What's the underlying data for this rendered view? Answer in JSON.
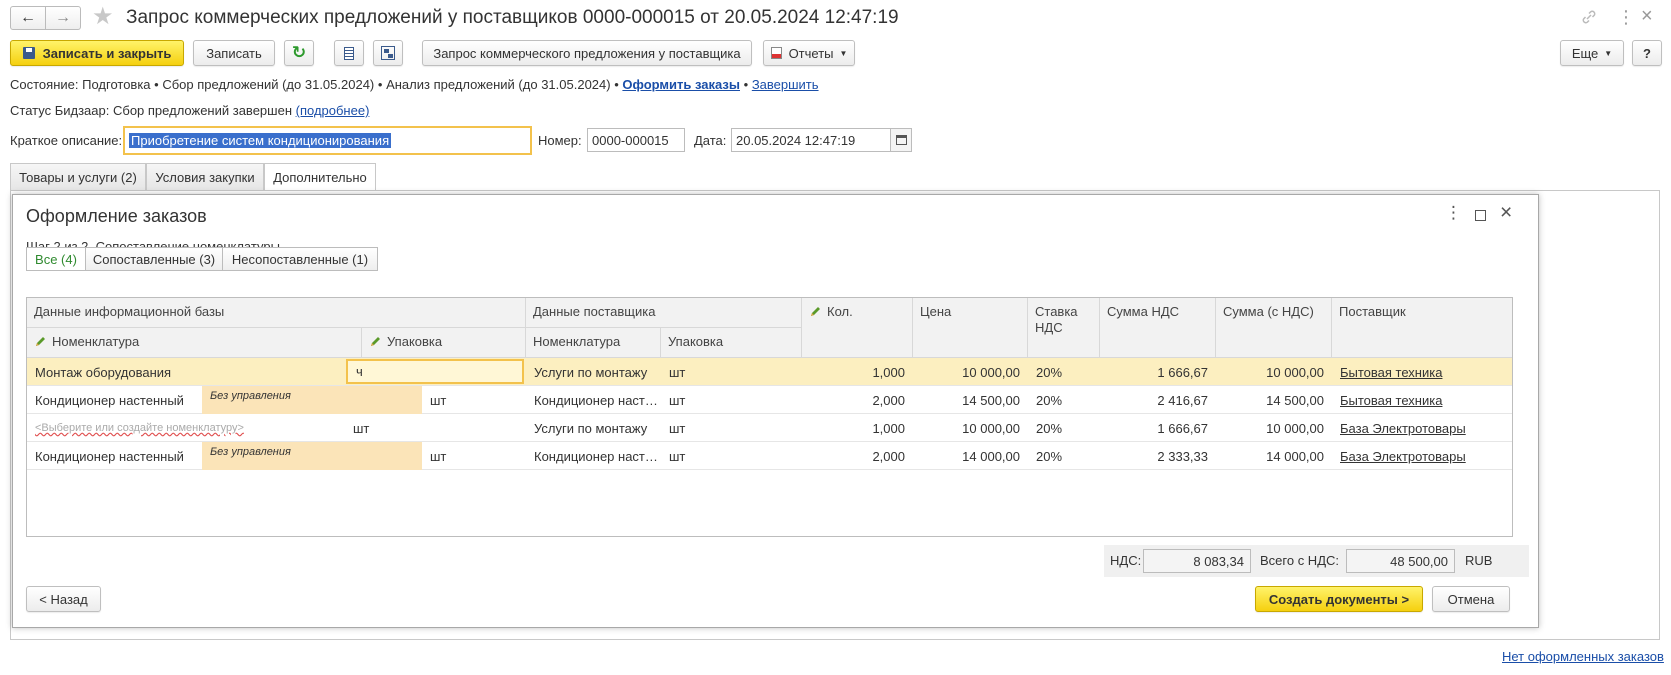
{
  "window": {
    "title": "Запрос коммерческих предложений у поставщиков 0000-000015 от 20.05.2024 12:47:19"
  },
  "toolbar": {
    "save_close": "Записать и закрыть",
    "save": "Записать",
    "request": "Запрос коммерческого предложения у поставщика",
    "reports": "Отчеты",
    "more": "Еще",
    "help": "?"
  },
  "status": {
    "label": "Состояние:",
    "steps": [
      "Подготовка",
      "Сбор предложений (до 31.05.2024)",
      "Анализ предложений (до 31.05.2024)"
    ],
    "make_orders": "Оформить заказы",
    "finish": "Завершить",
    "bidzaar_label": "Статус Бидзаар:",
    "bidzaar_value": "Сбор предложений завершен",
    "bidzaar_more": "(подробнее)"
  },
  "form": {
    "desc_label": "Краткое описание:",
    "desc_value": "Приобретение систем кондиционирования",
    "number_label": "Номер:",
    "number_value": "0000-000015",
    "date_label": "Дата:",
    "date_value": "20.05.2024 12:47:19"
  },
  "tabs": [
    "Товары и услуги (2)",
    "Условия закупки",
    "Дополнительно"
  ],
  "dialog": {
    "title": "Оформление заказов",
    "step": "Шаг 2 из 2. Сопоставление номенклатуры",
    "filters": [
      "Все (4)",
      "Сопоставленные (3)",
      "Несопоставленные (1)"
    ],
    "headers": {
      "ib_data": "Данные информационной базы",
      "supplier_data": "Данные поставщика",
      "nomenclature": "Номенклатура",
      "package": "Упаковка",
      "sup_nomenclature": "Номенклатура",
      "sup_package": "Упаковка",
      "qty": "Кол.",
      "price": "Цена",
      "vat_rate": "Ставка НДС",
      "vat_sum": "Сумма НДС",
      "sum_with_vat": "Сумма (с НДС)",
      "supplier": "Поставщик"
    },
    "rows": [
      {
        "nom": "Монтаж оборудования",
        "tag": "",
        "pack": "ч",
        "sup_nom": "Услуги по монтажу",
        "sup_pack": "шт",
        "qty": "1,000",
        "price": "10 000,00",
        "rate": "20%",
        "vat": "1 666,67",
        "sum": "10 000,00",
        "supplier": "Бытовая техника"
      },
      {
        "nom": "Кондиционер настенный",
        "tag": "Без управления",
        "pack": "шт",
        "sup_nom": "Кондиционер наст…",
        "sup_pack": "шт",
        "qty": "2,000",
        "price": "14 500,00",
        "rate": "20%",
        "vat": "2 416,67",
        "sum": "14 500,00",
        "supplier": "Бытовая техника"
      },
      {
        "nom": "<Выберите или создайте номенклатуру>",
        "tag": "",
        "pack": "шт",
        "sup_nom": "Услуги по монтажу",
        "sup_pack": "шт",
        "qty": "1,000",
        "price": "10 000,00",
        "rate": "20%",
        "vat": "1 666,67",
        "sum": "10 000,00",
        "supplier": "База Электротовары"
      },
      {
        "nom": "Кондиционер настенный",
        "tag": "Без управления",
        "pack": "шт",
        "sup_nom": "Кондиционер наст…",
        "sup_pack": "шт",
        "qty": "2,000",
        "price": "14 000,00",
        "rate": "20%",
        "vat": "2 333,33",
        "sum": "14 000,00",
        "supplier": "База Электротовары"
      }
    ],
    "totals": {
      "vat_label": "НДС:",
      "vat_value": "8 083,34",
      "total_label": "Всего с НДС:",
      "total_value": "48 500,00",
      "currency": "RUB"
    },
    "back": "< Назад",
    "create": "Создать документы >",
    "cancel": "Отмена"
  },
  "footer": {
    "no_orders": "Нет оформленных заказов"
  },
  "colors": {
    "accent_yellow": "#f5d00f",
    "selected_row": "#fcefc0",
    "link": "#1a4ea8",
    "active_filter": "#2f8a2f"
  }
}
